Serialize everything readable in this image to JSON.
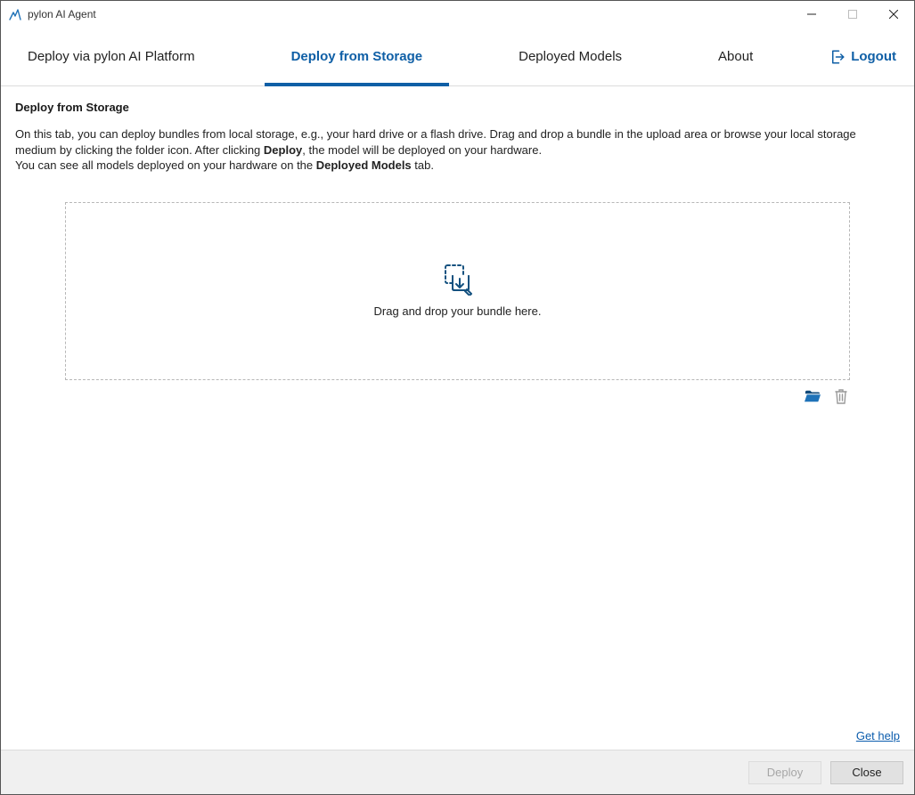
{
  "window": {
    "title": "pylon AI Agent"
  },
  "tabs": {
    "t0": "Deploy via pylon AI Platform",
    "t1": "Deploy from Storage",
    "t2": "Deployed Models",
    "t3": "About",
    "active_index": 1
  },
  "logout_label": "Logout",
  "page": {
    "heading": "Deploy from Storage",
    "desc_part1": "On this tab, you can deploy bundles from local storage, e.g., your hard drive or a flash drive. Drag and drop a bundle in the upload area or browse your local storage medium by clicking the folder icon. After clicking ",
    "desc_bold1": "Deploy",
    "desc_part2": ", the model will be deployed on your hardware.",
    "desc_line2a": "You can see all models deployed on your hardware on the ",
    "desc_bold2": "Deployed Models",
    "desc_line2b": " tab.",
    "dropzone_text": "Drag and drop your bundle here."
  },
  "help_link": "Get help",
  "footer": {
    "deploy": "Deploy",
    "close": "Close",
    "deploy_enabled": false
  },
  "colors": {
    "accent": "#0f5fa6"
  }
}
